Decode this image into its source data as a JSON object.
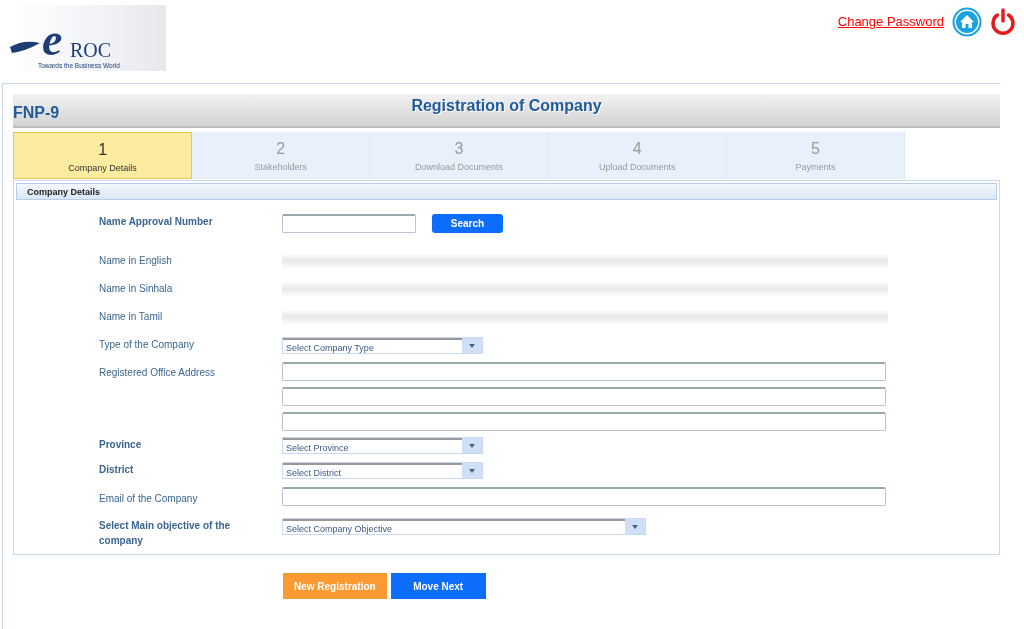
{
  "logo": {
    "mark": "e",
    "name": "ROC",
    "tagline": "Towards the Business World"
  },
  "header_links": {
    "change_password": "Change Password"
  },
  "page": {
    "code": "FNP-9",
    "title": "Registration of Company"
  },
  "steps": [
    {
      "number": "1",
      "label": "Company Details",
      "selected": true
    },
    {
      "number": "2",
      "label": "Stakeholders",
      "selected": false
    },
    {
      "number": "3",
      "label": "Download Documents",
      "selected": false
    },
    {
      "number": "4",
      "label": "Upload Documents",
      "selected": false
    },
    {
      "number": "5",
      "label": "Payments",
      "selected": false
    }
  ],
  "section_title": "Company Details",
  "fields": [
    {
      "kind": "search",
      "label": "Name Approval Number",
      "bold": true,
      "button": "Search"
    },
    {
      "kind": "display",
      "label": "Name in English",
      "bold": false
    },
    {
      "kind": "display",
      "label": "Name in Sinhala",
      "bold": false
    },
    {
      "kind": "display",
      "label": "Name in Tamil",
      "bold": false
    },
    {
      "kind": "select",
      "label": "Type of the Company",
      "bold": false,
      "placeholder": "Select Company Type"
    },
    {
      "kind": "address",
      "label": "Registered Office Address",
      "bold": false
    },
    {
      "kind": "select",
      "label": "Province",
      "bold": true,
      "placeholder": "Select Province"
    },
    {
      "kind": "select",
      "label": "District",
      "bold": true,
      "placeholder": "Select District"
    },
    {
      "kind": "text",
      "label": "Email of the Company",
      "bold": false
    },
    {
      "kind": "wideselect",
      "label": "Select Main objective of the company",
      "bold": true,
      "placeholder": "Select Company Objective"
    }
  ],
  "buttons": [
    {
      "label": "New Registration",
      "kind": "secondary"
    },
    {
      "label": "Move Next",
      "kind": "primary"
    }
  ]
}
